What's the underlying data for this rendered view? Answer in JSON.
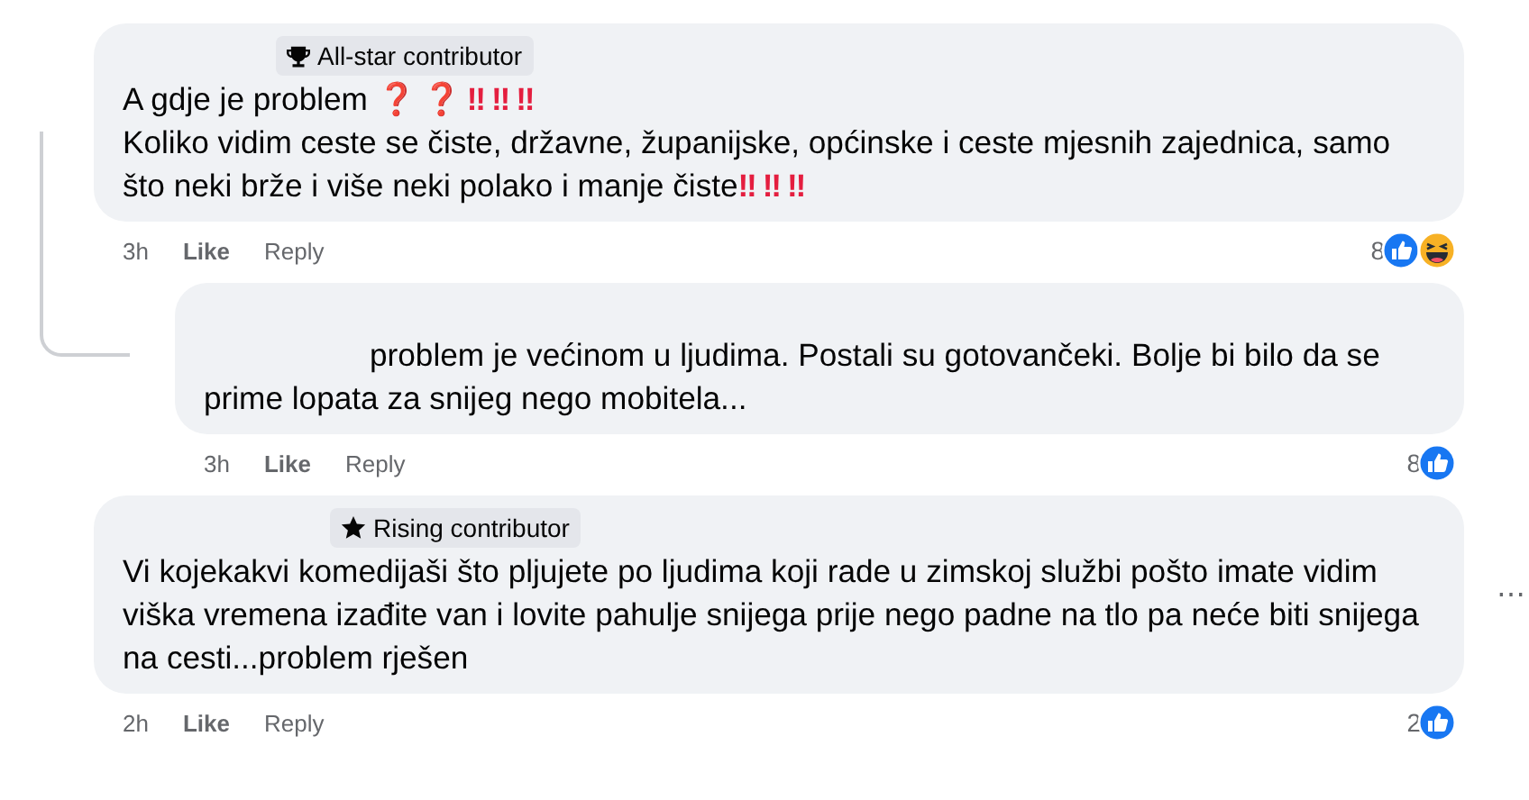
{
  "comments": [
    {
      "badge": {
        "kind": "trophy",
        "label": "All-star contributor"
      },
      "paragraphs": [
        [
          {
            "kind": "text",
            "text": "A gdje je problem "
          },
          {
            "kind": "emoji",
            "text": "❓❓‼‼‼"
          }
        ],
        [
          {
            "kind": "text",
            "text": "Koliko vidim ceste se čiste, državne, županijske, općinske i ceste mjesnih zajednica, samo što neki brže i više neki polako i manje čiste"
          },
          {
            "kind": "emoji",
            "text": "‼‼‼"
          }
        ]
      ],
      "time": "3h",
      "like": "Like",
      "reply": "Reply",
      "reaction_count": "8",
      "reactions": [
        {
          "kind": "like"
        },
        {
          "kind": "haha"
        }
      ],
      "replies": [
        {
          "paragraphs": [
            [
              {
                "kind": "text",
                "text": "problem je većinom u ljudima. Postali su gotovančeki. Bolje bi bilo da se prime lopata za snijeg nego mobitela..."
              }
            ]
          ],
          "time": "3h",
          "like": "Like",
          "reply": "Reply",
          "reaction_count": "8",
          "reactions": [
            {
              "kind": "like"
            }
          ]
        }
      ]
    },
    {
      "badge": {
        "kind": "star",
        "label": "Rising contributor"
      },
      "paragraphs": [
        [
          {
            "kind": "text",
            "text": "Vi kojekakvi komedijaši što pljujete po ljudima koji rade u zimskoj službi pošto imate vidim viška vremena izađite van i lovite pahulje snijega prije nego padne na tlo pa neće biti snijega na cesti...problem rješen"
          }
        ]
      ],
      "time": "2h",
      "like": "Like",
      "reply": "Reply",
      "reaction_count": "2",
      "reactions": [
        {
          "kind": "like"
        }
      ],
      "more": "⋯"
    }
  ]
}
